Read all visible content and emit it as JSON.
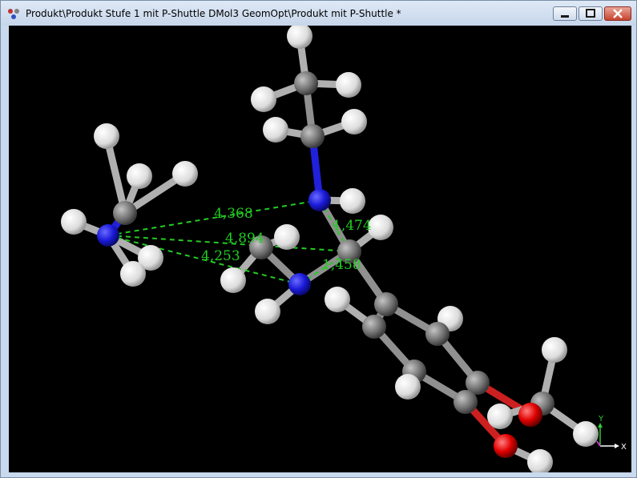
{
  "window": {
    "title": "Produkt\\Produkt Stufe 1 mit P-Shuttle DMol3 GeomOpt\\Produkt mit P-Shuttle *",
    "controls": {
      "minimize": "minimize",
      "maximize": "maximize",
      "close": "close"
    }
  },
  "viewer": {
    "background": "#000000",
    "measure_color": "#22cc22",
    "measurements": [
      "4,368",
      "4,894",
      "4,253",
      "1,474",
      "1,458"
    ],
    "axes": {
      "x_label": "X",
      "y_label": "Y"
    },
    "atom_colors": {
      "hydrogen": "#e8e8e8",
      "carbon": "#808080",
      "nitrogen": "#1a1acc",
      "oxygen": "#dd0000"
    }
  }
}
